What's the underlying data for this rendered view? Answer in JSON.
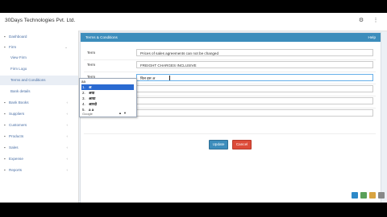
{
  "app": {
    "brand": "30Days Technologies Pvt. Ltd."
  },
  "topbar": {
    "icons": [
      "gear-icon",
      "more-vert-icon"
    ]
  },
  "sidebar": {
    "items": [
      {
        "label": "Dashboard",
        "icon": "home-icon",
        "has_children": false
      },
      {
        "label": "Firm",
        "icon": "building-icon",
        "has_children": true
      },
      {
        "label": "Bank Books",
        "icon": "book-icon",
        "has_children": true
      },
      {
        "label": "Suppliers",
        "icon": "truck-icon",
        "has_children": true
      },
      {
        "label": "Customers",
        "icon": "users-icon",
        "has_children": true
      },
      {
        "label": "Products",
        "icon": "cart-icon",
        "has_children": true
      },
      {
        "label": "Sales",
        "icon": "tag-icon",
        "has_children": true
      },
      {
        "label": "Expense",
        "icon": "wallet-icon",
        "has_children": true
      },
      {
        "label": "Reports",
        "icon": "chart-icon",
        "has_children": true
      }
    ],
    "firm_children": [
      "View Firm",
      "Firm Logo",
      "Terms and Conditions",
      "Bank details"
    ],
    "active_child": "Terms and Conditions"
  },
  "panel": {
    "title": "Terms & Conditions",
    "help": "Help",
    "rows": [
      {
        "label": "Term",
        "value": "Prices of sales agreements can not be changed"
      },
      {
        "label": "Term",
        "value": "FREIGHT CHARGES INCLUSIVE"
      },
      {
        "label": "Term",
        "value": "बिल इस अ"
      },
      {
        "label": "Term",
        "value": ""
      },
      {
        "label": "Term",
        "value": ""
      },
      {
        "label": "Term",
        "value": ""
      }
    ],
    "update_label": "Update",
    "cancel_label": "Cancel"
  },
  "ime": {
    "composition": "aa",
    "candidates": [
      "अ",
      "अया",
      "आया",
      "आरदो",
      "a a"
    ],
    "selected_index": 0,
    "footer": "Google"
  },
  "colors": {
    "primary": "#3c8dbc",
    "danger": "#dd4b39",
    "ime_select": "#2a6ad1"
  }
}
